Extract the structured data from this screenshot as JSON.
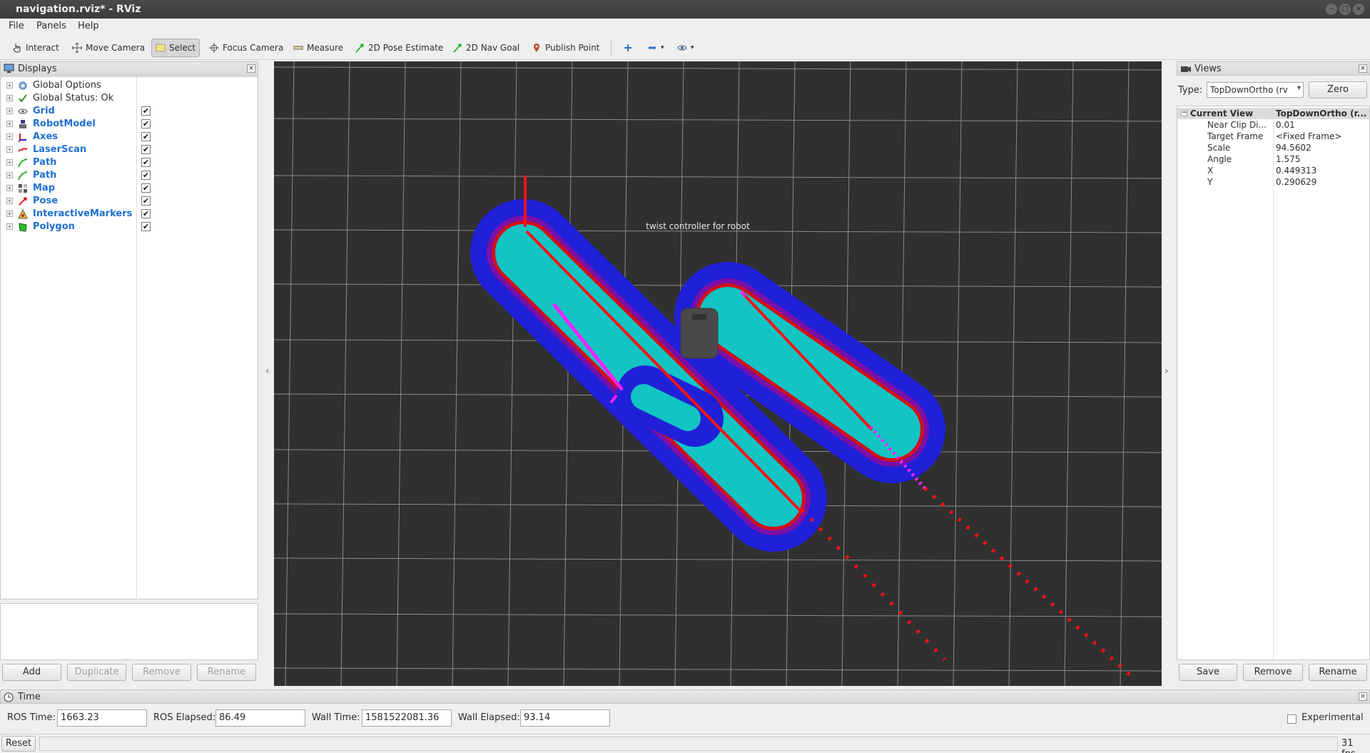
{
  "window": {
    "title": "navigation.rviz* - RViz"
  },
  "menu": [
    "File",
    "Panels",
    "Help"
  ],
  "toolbar": {
    "interact": "Interact",
    "move_camera": "Move Camera",
    "select": "Select",
    "focus_camera": "Focus Camera",
    "measure": "Measure",
    "pose_estimate": "2D Pose Estimate",
    "nav_goal": "2D Nav Goal",
    "publish_point": "Publish Point"
  },
  "displays": {
    "title": "Displays",
    "items": [
      {
        "label": "Global Options",
        "icon": "gear-icon",
        "checked": null,
        "highlight": false
      },
      {
        "label": "Global Status: Ok",
        "icon": "checkmark-icon",
        "checked": null,
        "highlight": false
      },
      {
        "label": "Grid",
        "icon": "grid-icon",
        "checked": true,
        "highlight": true
      },
      {
        "label": "RobotModel",
        "icon": "robot-icon",
        "checked": true,
        "highlight": true
      },
      {
        "label": "Axes",
        "icon": "axes-icon",
        "checked": true,
        "highlight": true
      },
      {
        "label": "LaserScan",
        "icon": "laserscan-icon",
        "checked": true,
        "highlight": true
      },
      {
        "label": "Path",
        "icon": "path-icon",
        "checked": true,
        "highlight": true
      },
      {
        "label": "Path",
        "icon": "path-icon",
        "checked": true,
        "highlight": true
      },
      {
        "label": "Map",
        "icon": "map-icon",
        "checked": true,
        "highlight": true
      },
      {
        "label": "Pose",
        "icon": "pose-arrow-icon",
        "checked": true,
        "highlight": true
      },
      {
        "label": "InteractiveMarkers",
        "icon": "interactive-markers-icon",
        "checked": true,
        "highlight": true
      },
      {
        "label": "Polygon",
        "icon": "polygon-icon",
        "checked": true,
        "highlight": true
      }
    ],
    "buttons": {
      "add": "Add",
      "duplicate": "Duplicate",
      "remove": "Remove",
      "rename": "Rename"
    }
  },
  "viewport": {
    "marker_text": "twist  controller  for  robot"
  },
  "views": {
    "title": "Views",
    "type_label": "Type:",
    "type_value": "TopDownOrtho (rv",
    "zero": "Zero",
    "current_view": {
      "key": "Current View",
      "value": "TopDownOrtho (r..."
    },
    "properties": [
      {
        "key": "Near Clip Di...",
        "value": "0.01"
      },
      {
        "key": "Target Frame",
        "value": "<Fixed Frame>"
      },
      {
        "key": "Scale",
        "value": "94.5602"
      },
      {
        "key": "Angle",
        "value": "1.575"
      },
      {
        "key": "X",
        "value": "0.449313"
      },
      {
        "key": "Y",
        "value": "0.290629"
      }
    ],
    "buttons": {
      "save": "Save",
      "remove": "Remove",
      "rename": "Rename"
    }
  },
  "time": {
    "title": "Time",
    "ros_time_label": "ROS Time:",
    "ros_time": "1663.23",
    "ros_elapsed_label": "ROS Elapsed:",
    "ros_elapsed": "86.49",
    "wall_time_label": "Wall Time:",
    "wall_time": "1581522081.36",
    "wall_elapsed_label": "Wall Elapsed:",
    "wall_elapsed": "93.14",
    "experimental": "Experimental"
  },
  "status": {
    "reset": "Reset",
    "fps": "31 fps"
  },
  "colors": {
    "viewport_bg": "#303030",
    "costmap_inner": "#12c4c4",
    "costmap_outer": "#2020d8",
    "path_red": "#ff1010",
    "path_magenta": "#ff20ff",
    "accent_blue": "#1f6fd1"
  }
}
